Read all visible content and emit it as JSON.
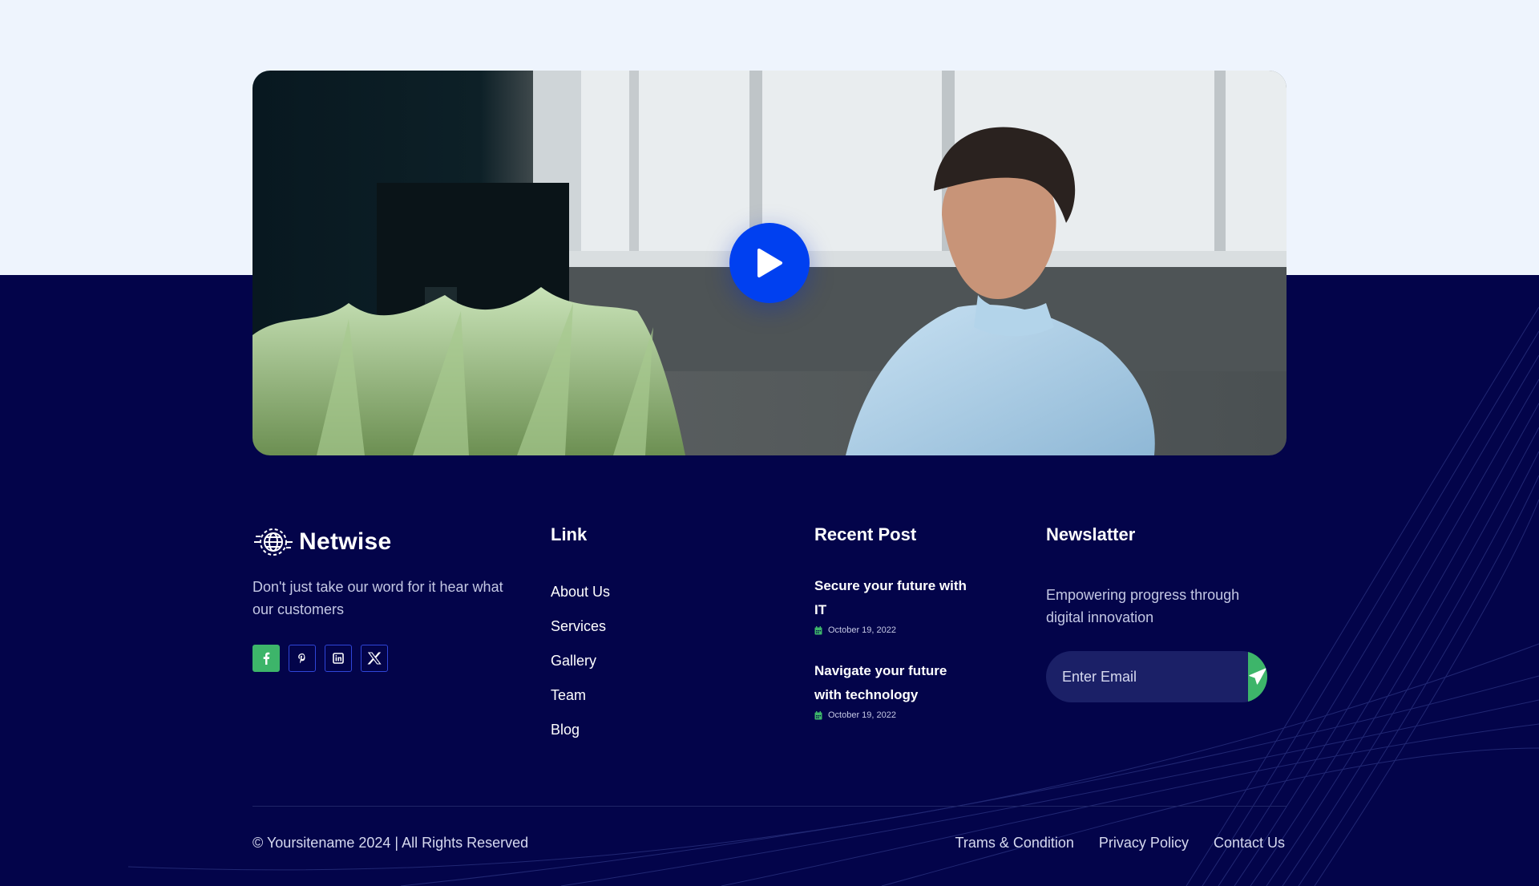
{
  "video": {
    "play_icon": "play-icon"
  },
  "brand": {
    "name": "Netwise",
    "logo_icon": "globe-gear-icon",
    "description": "Don't just take our word for it hear what our customers"
  },
  "socials": [
    {
      "name": "facebook",
      "icon": "facebook-icon",
      "label": "f"
    },
    {
      "name": "pinterest",
      "icon": "pinterest-icon",
      "label": "P"
    },
    {
      "name": "linkedin",
      "icon": "linkedin-icon",
      "label": "in"
    },
    {
      "name": "x",
      "icon": "x-icon",
      "label": "X"
    }
  ],
  "links": {
    "title": "Link",
    "items": [
      "About Us",
      "Services",
      "Gallery",
      "Team",
      "Blog"
    ]
  },
  "recent_posts": {
    "title": "Recent Post",
    "items": [
      {
        "title": "Secure your future with IT",
        "date": "October 19, 2022"
      },
      {
        "title": "Navigate your future with technology",
        "date": "October 19, 2022"
      }
    ]
  },
  "newsletter": {
    "title": "Newslatter",
    "description": "Empowering progress through digital innovation",
    "placeholder": "Enter Email",
    "send_icon": "paper-plane-icon"
  },
  "bottom": {
    "copyright": "© Yoursitename  2024 | All Rights Reserved",
    "legal_links": [
      "Trams & Condition",
      "Privacy Policy",
      "Contact Us"
    ]
  },
  "colors": {
    "top_background": "#eef4fd",
    "footer_background": "#03044a",
    "accent_blue": "#0040f0",
    "accent_green": "#3db56a"
  }
}
